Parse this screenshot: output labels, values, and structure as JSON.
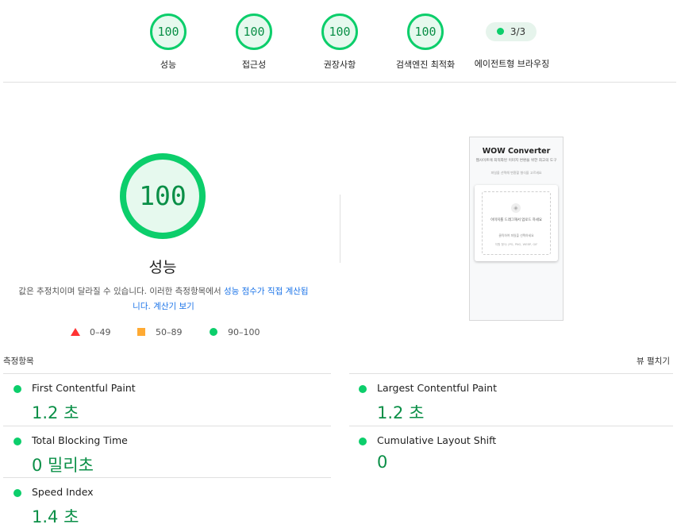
{
  "summary_gauges": [
    {
      "score": "100",
      "label": "성능"
    },
    {
      "score": "100",
      "label": "접근성"
    },
    {
      "score": "100",
      "label": "권장사항"
    },
    {
      "score": "100",
      "label": "검색엔진 최적화"
    }
  ],
  "pwa": {
    "value": "3/3",
    "label": "에이전트형 브라우징"
  },
  "performance": {
    "score": "100",
    "score_fraction": 1.0,
    "title": "성능",
    "desc_prefix": "값은 추정치이며 달라질 수 있습니다. 이러한 측정항목에서 ",
    "desc_link1": "성능 점수가 직접 계산됩",
    "desc_link1b": "니다.",
    "desc_link2": "계산기 보기",
    "legend": {
      "fail": "0–49",
      "average": "50–89",
      "pass": "90–100"
    }
  },
  "screenshot": {
    "title": "WOW Converter",
    "subtitle": "웹사이트에 최적화된 이미지 변환을 위한 최고의 도구",
    "subtitle2": "파일을 선택해 변환할 형식을 고르세요",
    "drop_text": "이미지를 드래그해서 업로드 하세요",
    "drop_sub": "클릭하여 파일을 선택하세요",
    "drop_formats": "지원 형식: JPG, PNG, WEBP, GIF"
  },
  "metrics": {
    "header": "측정항목",
    "toggle": "뷰 펼치기",
    "items": [
      {
        "name": "First Contentful Paint",
        "value": "1.2 초"
      },
      {
        "name": "Largest Contentful Paint",
        "value": "1.2 초"
      },
      {
        "name": "Total Blocking Time",
        "value": "0 밀리초"
      },
      {
        "name": "Cumulative Layout Shift",
        "value": "0"
      },
      {
        "name": "Speed Index",
        "value": "1.4 초"
      }
    ]
  },
  "colors": {
    "pass": "#0cce6b",
    "pass_text": "#0a8f47",
    "average": "#ffaa33",
    "fail": "#ff3333",
    "link": "#1a73e8"
  }
}
